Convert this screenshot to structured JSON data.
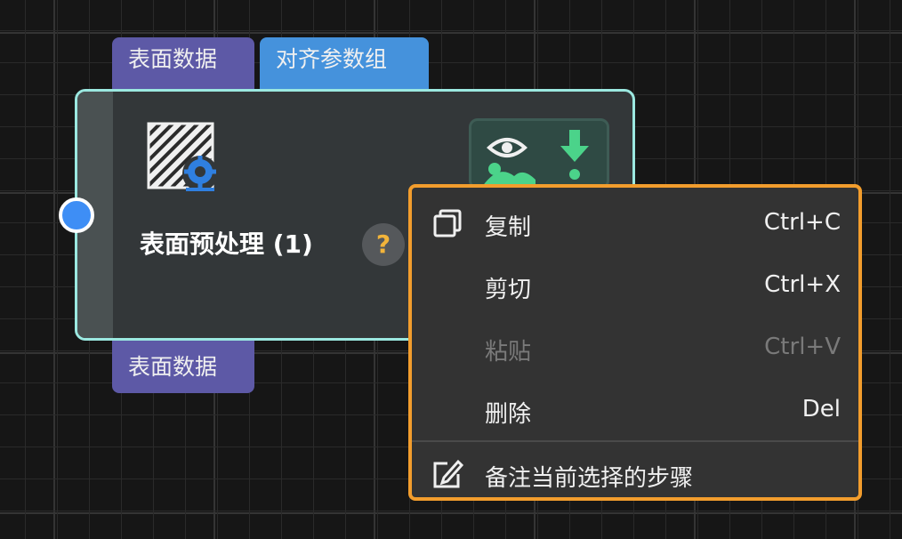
{
  "node": {
    "title": "表面预处理 (1)",
    "help_glyph": "?",
    "inputs": [
      {
        "label": "表面数据",
        "color": "#5d59a6"
      },
      {
        "label": "对齐参数组",
        "color": "#4592dc"
      }
    ],
    "outputs": [
      {
        "label": "表面数据",
        "color": "#5d59a6"
      }
    ],
    "icon": "surface-gear-icon",
    "view_toggle_icons": [
      "eye-landscape-icon",
      "download-arrow-icon"
    ],
    "border_color": "#9be8e0",
    "input_port_color": "#3e8ef5"
  },
  "context_menu": {
    "border_color": "#f29d2d",
    "items": [
      {
        "label": "复制",
        "shortcut": "Ctrl+C",
        "icon": "copy-icon",
        "enabled": true
      },
      {
        "label": "剪切",
        "shortcut": "Ctrl+X",
        "enabled": true
      },
      {
        "label": "粘贴",
        "shortcut": "Ctrl+V",
        "enabled": false
      },
      {
        "label": "删除",
        "shortcut": "Del",
        "enabled": true
      },
      {
        "label": "备注当前选择的步骤",
        "shortcut": "",
        "icon": "edit-note-icon",
        "enabled": true
      }
    ]
  }
}
